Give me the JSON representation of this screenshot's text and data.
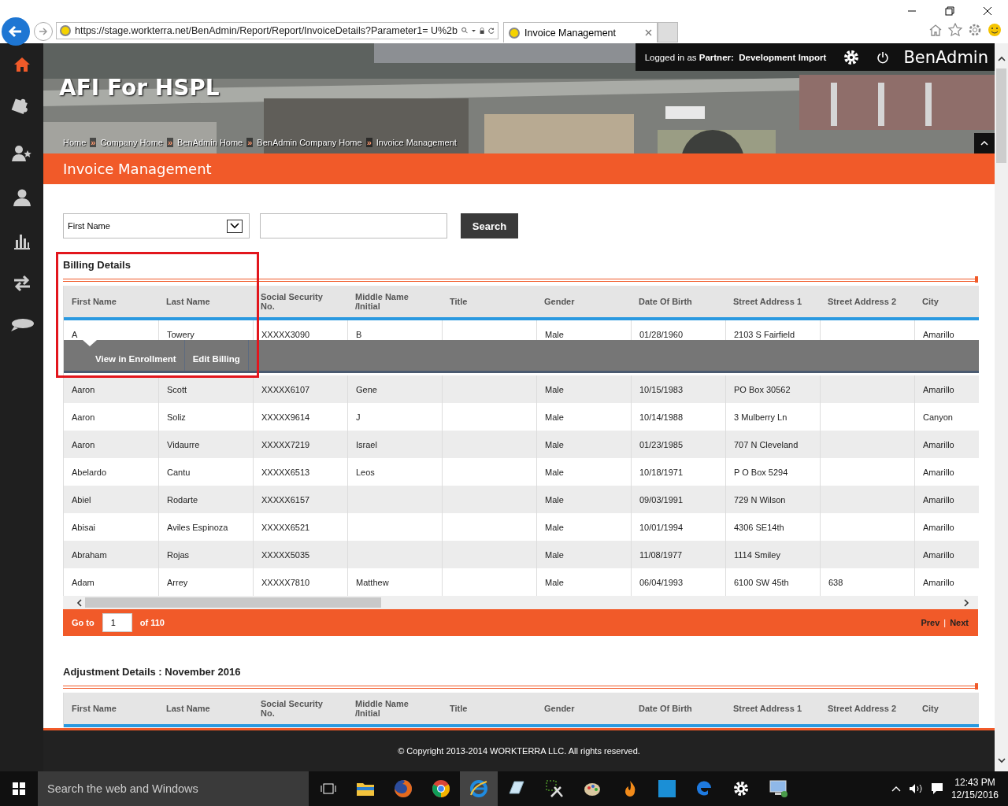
{
  "browser": {
    "url": "https://stage.workterra.net/BenAdmin/Report/Report/InvoiceDetails?Parameter1= U%2b",
    "tab_title": "Invoice Management"
  },
  "header": {
    "login_prefix": "Logged in as",
    "login_role": "Partner:",
    "login_name": "Development Import",
    "brand": "BenAdmin",
    "site_title": "AFI For HSPL",
    "breadcrumb_separator": "»",
    "breadcrumbs": [
      "Home",
      "Company Home",
      "BenAdmin Home",
      "BenAdmin Company Home",
      "Invoice Management"
    ]
  },
  "page_title": "Invoice Management",
  "search": {
    "field_value": "First Name",
    "button": "Search"
  },
  "billing": {
    "title": "Billing Details",
    "headers": [
      "First Name",
      "Last Name",
      "Social Security No.",
      "Middle Name /Initial",
      "Title",
      "Gender",
      "Date Of Birth",
      "Street Address 1",
      "Street Address 2",
      "City"
    ],
    "rows": [
      {
        "cells": [
          "A",
          "Towery",
          "XXXXX3090",
          "B",
          "",
          "Male",
          "01/28/1960",
          "2103 S Fairfield",
          "",
          "Amarillo"
        ],
        "selected": true
      },
      {
        "cells": [
          "Aaron",
          "Scott",
          "XXXXX6107",
          "Gene",
          "",
          "Male",
          "10/15/1983",
          "PO Box 30562",
          "",
          "Amarillo"
        ],
        "selected": false
      },
      {
        "cells": [
          "Aaron",
          "Soliz",
          "XXXXX9614",
          "J",
          "",
          "Male",
          "10/14/1988",
          "3 Mulberry Ln",
          "",
          "Canyon"
        ],
        "selected": false
      },
      {
        "cells": [
          "Aaron",
          "Vidaurre",
          "XXXXX7219",
          "Israel",
          "",
          "Male",
          "01/23/1985",
          "707 N Cleveland",
          "",
          "Amarillo"
        ],
        "selected": false
      },
      {
        "cells": [
          "Abelardo",
          "Cantu",
          "XXXXX6513",
          "Leos",
          "",
          "Male",
          "10/18/1971",
          "P O Box 5294",
          "",
          "Amarillo"
        ],
        "selected": false
      },
      {
        "cells": [
          "Abiel",
          "Rodarte",
          "XXXXX6157",
          "",
          "",
          "Male",
          "09/03/1991",
          "729 N Wilson",
          "",
          "Amarillo"
        ],
        "selected": false
      },
      {
        "cells": [
          "Abisai",
          "Aviles Espinoza",
          "XXXXX6521",
          "",
          "",
          "Male",
          "10/01/1994",
          "4306 SE14th",
          "",
          "Amarillo"
        ],
        "selected": false
      },
      {
        "cells": [
          "Abraham",
          "Rojas",
          "XXXXX5035",
          "",
          "",
          "Male",
          "11/08/1977",
          "1114 Smiley",
          "",
          "Amarillo"
        ],
        "selected": false
      },
      {
        "cells": [
          "Adam",
          "Arrey",
          "XXXXX7810",
          "Matthew",
          "",
          "Male",
          "06/04/1993",
          "6100 SW 45th",
          "638",
          "Amarillo"
        ],
        "selected": false
      }
    ],
    "row_actions": [
      "View in Enrollment",
      "Edit Billing"
    ],
    "pager": {
      "goto_label": "Go to",
      "page": "1",
      "of_label": "of 110",
      "prev": "Prev",
      "separator": "|",
      "next": "Next"
    }
  },
  "adjustment": {
    "title": "Adjustment Details : November 2016",
    "headers": [
      "First Name",
      "Last Name",
      "Social Security No.",
      "Middle Name /Initial",
      "Title",
      "Gender",
      "Date Of Birth",
      "Street Address 1",
      "Street Address 2",
      "City"
    ]
  },
  "footer": {
    "copyright": "© Copyright 2013-2014 WORKTERRA LLC. All rights reserved."
  },
  "taskbar": {
    "search": "Search the web and Windows",
    "time": "12:43 PM",
    "date": "12/15/2016"
  }
}
